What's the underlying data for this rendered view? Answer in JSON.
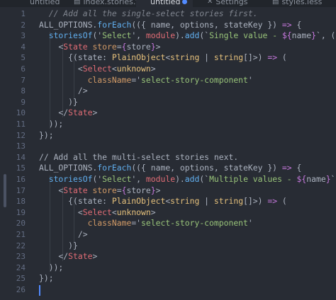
{
  "tabs": [
    {
      "label": "untitled",
      "icon": "",
      "active": false,
      "modified": false
    },
    {
      "label": "index.stories.tsx",
      "icon": "file-icon",
      "active": false,
      "modified": false
    },
    {
      "label": "untitled",
      "icon": "",
      "active": true,
      "modified": true
    },
    {
      "label": "Settings",
      "icon": "wrench-icon",
      "active": false,
      "modified": false
    },
    {
      "label": "styles.less",
      "icon": "file-icon",
      "active": false,
      "modified": false
    }
  ],
  "editor": {
    "cursor_line": 26,
    "lines": [
      {
        "n": "1",
        "tokens": [
          [
            "cm",
            "  // Add all the single-select stories first."
          ]
        ]
      },
      {
        "n": "2",
        "tokens": [
          [
            "p",
            "ALL_OPTIONS."
          ],
          [
            "fn",
            "forEach"
          ],
          [
            "p",
            "(({ name, options, stateKey }) "
          ],
          [
            "k",
            "=>"
          ],
          [
            "p",
            " {"
          ]
        ]
      },
      {
        "n": "3",
        "tokens": [
          [
            "p",
            "  "
          ],
          [
            "fn",
            "storiesOf"
          ],
          [
            "p",
            "('"
          ],
          [
            "str",
            "Select"
          ],
          [
            "p",
            "', "
          ],
          [
            "var",
            "module"
          ],
          [
            "p",
            ")."
          ],
          [
            "fn",
            "add"
          ],
          [
            "p",
            "(`"
          ],
          [
            "str",
            "Single value - "
          ],
          [
            "k",
            "${"
          ],
          [
            "p",
            "name"
          ],
          [
            "k",
            "}"
          ],
          [
            "p",
            "`, () "
          ],
          [
            "k",
            "=>"
          ],
          [
            "p",
            " ("
          ]
        ]
      },
      {
        "n": "4",
        "tokens": [
          [
            "p",
            "    <"
          ],
          [
            "tag",
            "State"
          ],
          [
            "p",
            " "
          ],
          [
            "attr",
            "store"
          ],
          [
            "p",
            "="
          ],
          [
            "k",
            "{"
          ],
          [
            "p",
            "store"
          ],
          [
            "k",
            "}"
          ],
          [
            "p",
            ">"
          ]
        ]
      },
      {
        "n": "5",
        "tokens": [
          [
            "p",
            "      {(state: "
          ],
          [
            "ty",
            "PlainObject"
          ],
          [
            "p",
            "<"
          ],
          [
            "ty",
            "string"
          ],
          [
            "p",
            " | "
          ],
          [
            "ty",
            "string"
          ],
          [
            "p",
            "[]>) "
          ],
          [
            "k",
            "=>"
          ],
          [
            "p",
            " ("
          ]
        ]
      },
      {
        "n": "6",
        "tokens": [
          [
            "p",
            "        <"
          ],
          [
            "tag",
            "Select"
          ],
          [
            "p",
            "<"
          ],
          [
            "ty",
            "unknown"
          ],
          [
            "p",
            ">"
          ]
        ]
      },
      {
        "n": "7",
        "tokens": [
          [
            "p",
            "          "
          ],
          [
            "attr",
            "className"
          ],
          [
            "p",
            "='"
          ],
          [
            "str",
            "select-story-component"
          ],
          [
            "p",
            "'"
          ]
        ]
      },
      {
        "n": "8",
        "tokens": [
          [
            "p",
            "        />"
          ]
        ]
      },
      {
        "n": "9",
        "tokens": [
          [
            "p",
            "      )}"
          ]
        ]
      },
      {
        "n": "10",
        "tokens": [
          [
            "p",
            "    </"
          ],
          [
            "tag",
            "State"
          ],
          [
            "p",
            ">"
          ]
        ]
      },
      {
        "n": "11",
        "tokens": [
          [
            "p",
            "  ));"
          ]
        ]
      },
      {
        "n": "12",
        "tokens": [
          [
            "p",
            "});"
          ]
        ]
      },
      {
        "n": "13",
        "tokens": []
      },
      {
        "n": "14",
        "tokens": [
          [
            "p",
            "// Add all the multi-select stories next."
          ]
        ]
      },
      {
        "n": "15",
        "tokens": [
          [
            "p",
            "ALL_OPTIONS."
          ],
          [
            "fn",
            "forEach"
          ],
          [
            "p",
            "(({ name, options, stateKey }) "
          ],
          [
            "k",
            "=>"
          ],
          [
            "p",
            " {"
          ]
        ]
      },
      {
        "n": "16",
        "tokens": [
          [
            "p",
            "  "
          ],
          [
            "fn",
            "storiesOf"
          ],
          [
            "p",
            "('"
          ],
          [
            "str",
            "Select"
          ],
          [
            "p",
            "', "
          ],
          [
            "var",
            "module"
          ],
          [
            "p",
            ")."
          ],
          [
            "fn",
            "add"
          ],
          [
            "p",
            "(`"
          ],
          [
            "str",
            "Multiple values - "
          ],
          [
            "k",
            "${"
          ],
          [
            "p",
            "name"
          ],
          [
            "k",
            "}"
          ],
          [
            "p",
            "`, () "
          ],
          [
            "k",
            "=>"
          ],
          [
            "p",
            " ("
          ]
        ]
      },
      {
        "n": "17",
        "tokens": [
          [
            "p",
            "    <"
          ],
          [
            "tag",
            "State"
          ],
          [
            "p",
            " "
          ],
          [
            "attr",
            "store"
          ],
          [
            "p",
            "="
          ],
          [
            "k",
            "{"
          ],
          [
            "p",
            "store"
          ],
          [
            "k",
            "}"
          ],
          [
            "p",
            ">"
          ]
        ]
      },
      {
        "n": "18",
        "tokens": [
          [
            "p",
            "      {(state: "
          ],
          [
            "ty",
            "PlainObject"
          ],
          [
            "p",
            "<"
          ],
          [
            "ty",
            "string"
          ],
          [
            "p",
            " | "
          ],
          [
            "ty",
            "string"
          ],
          [
            "p",
            "[]>) "
          ],
          [
            "k",
            "=>"
          ],
          [
            "p",
            " ("
          ]
        ]
      },
      {
        "n": "19",
        "tokens": [
          [
            "p",
            "        <"
          ],
          [
            "tag",
            "Select"
          ],
          [
            "p",
            "<"
          ],
          [
            "ty",
            "unknown"
          ],
          [
            "p",
            ">"
          ]
        ]
      },
      {
        "n": "20",
        "tokens": [
          [
            "p",
            "          "
          ],
          [
            "attr",
            "className"
          ],
          [
            "p",
            "='"
          ],
          [
            "str",
            "select-story-component"
          ],
          [
            "p",
            "'"
          ]
        ]
      },
      {
        "n": "21",
        "tokens": [
          [
            "p",
            "        />"
          ]
        ]
      },
      {
        "n": "22",
        "tokens": [
          [
            "p",
            "      )}"
          ]
        ]
      },
      {
        "n": "23",
        "tokens": [
          [
            "p",
            "    </"
          ],
          [
            "tag",
            "State"
          ],
          [
            "p",
            ">"
          ]
        ]
      },
      {
        "n": "24",
        "tokens": [
          [
            "p",
            "  ));"
          ]
        ]
      },
      {
        "n": "25",
        "tokens": [
          [
            "p",
            "});"
          ]
        ]
      },
      {
        "n": "26",
        "tokens": []
      }
    ]
  },
  "colors": {
    "background": "#282c34",
    "tabbar": "#21252b",
    "cursor": "#528bff"
  }
}
